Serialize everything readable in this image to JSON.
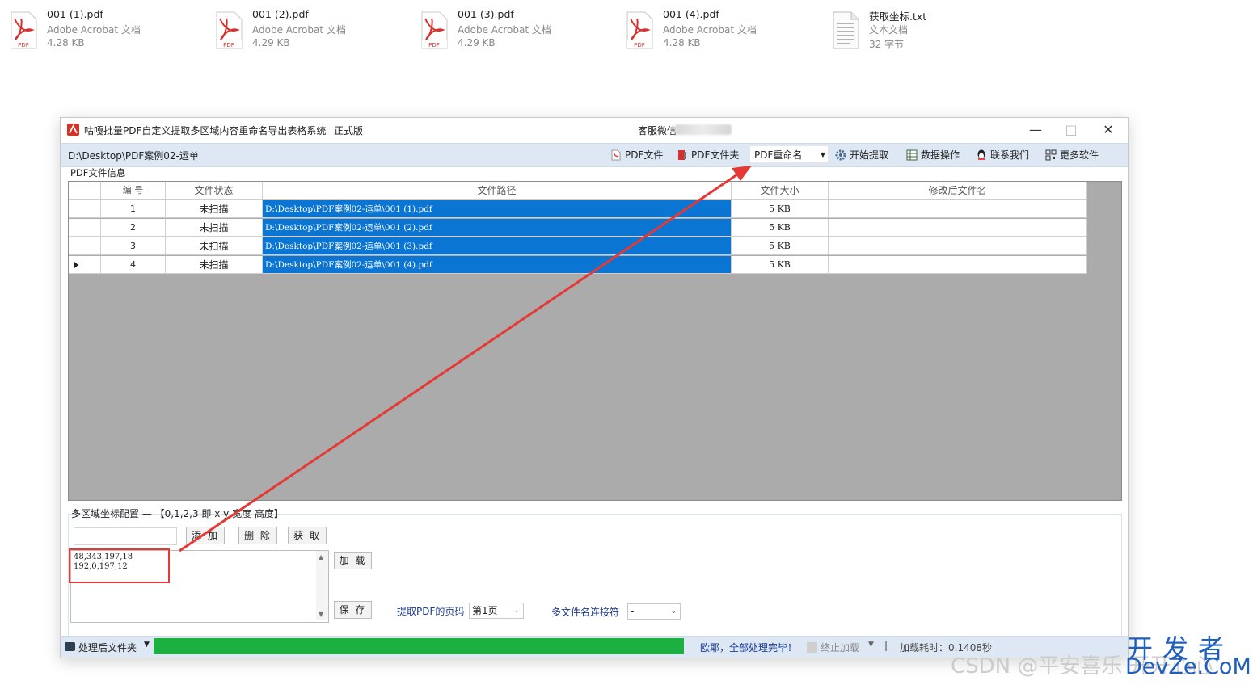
{
  "desktop_files": [
    {
      "name": "001 (1).pdf",
      "type": "Adobe Acrobat 文档",
      "size": "4.28 KB",
      "icon": "pdf-icon"
    },
    {
      "name": "001 (2).pdf",
      "type": "Adobe Acrobat 文档",
      "size": "4.29 KB",
      "icon": "pdf-icon"
    },
    {
      "name": "001 (3).pdf",
      "type": "Adobe Acrobat 文档",
      "size": "4.29 KB",
      "icon": "pdf-icon"
    },
    {
      "name": "001 (4).pdf",
      "type": "Adobe Acrobat 文档",
      "size": "4.28 KB",
      "icon": "pdf-icon"
    },
    {
      "name": "获取坐标.txt",
      "type": "文本文档",
      "size": "32 字节",
      "icon": "text-file-icon"
    }
  ],
  "window": {
    "title": "咕嘎批量PDF自定义提取多区域内容重命名导出表格系统",
    "edition": "正式版",
    "customer_service": "客服微信"
  },
  "toolbar": {
    "path": "D:\\Desktop\\PDF案例02-运单",
    "pdf_file": "PDF文件",
    "pdf_folder": "PDF文件夹",
    "mode_selected": "PDF重命名",
    "start": "开始提取",
    "data_ops": "数据操作",
    "contact": "联系我们",
    "more": "更多软件"
  },
  "grid": {
    "group_label": "PDF文件信息",
    "headers": [
      "编 号",
      "文件状态",
      "文件路径",
      "文件大小",
      "修改后文件名"
    ],
    "rows": [
      {
        "no": "1",
        "status": "未扫描",
        "path": "D:\\Desktop\\PDF案例02-运单\\001 (1).pdf",
        "size": "5 KB",
        "new_name": ""
      },
      {
        "no": "2",
        "status": "未扫描",
        "path": "D:\\Desktop\\PDF案例02-运单\\001 (2).pdf",
        "size": "5 KB",
        "new_name": ""
      },
      {
        "no": "3",
        "status": "未扫描",
        "path": "D:\\Desktop\\PDF案例02-运单\\001 (3).pdf",
        "size": "5 KB",
        "new_name": ""
      },
      {
        "no": "4",
        "status": "未扫描",
        "path": "D:\\Desktop\\PDF案例02-运单\\001 (4).pdf",
        "size": "5 KB",
        "new_name": ""
      }
    ]
  },
  "coords": {
    "title": "多区域坐标配置 — 【0,1,2,3 即 x y 宽度 高度】",
    "add": "添 加",
    "delete": "删 除",
    "get": "获 取",
    "load": "加 载",
    "save": "保 存",
    "values": [
      "48,343,197,18",
      "192,0,197,12"
    ],
    "page_label": "提取PDF的页码",
    "page_value": "第1页",
    "joiner_label": "多文件名连接符",
    "joiner_value": "-"
  },
  "status": {
    "output_folder": "处理后文件夹",
    "progress_fraction": 1.0,
    "done_text": "欧耶，全部处理完毕！",
    "stop_load": "终止加载",
    "separator": "|",
    "elapsed": "加载耗时：0.1408秒"
  },
  "watermark": {
    "csdn": "CSDN @平安喜乐 开开心心",
    "devze_cn": "开发者",
    "devze_en": "DevZe.CoM"
  },
  "colors": {
    "accent_blue": "#0a75d2",
    "progress_green": "#1bb040",
    "annotation_red": "#e53935",
    "toolbar_bg": "#dde8f4"
  }
}
